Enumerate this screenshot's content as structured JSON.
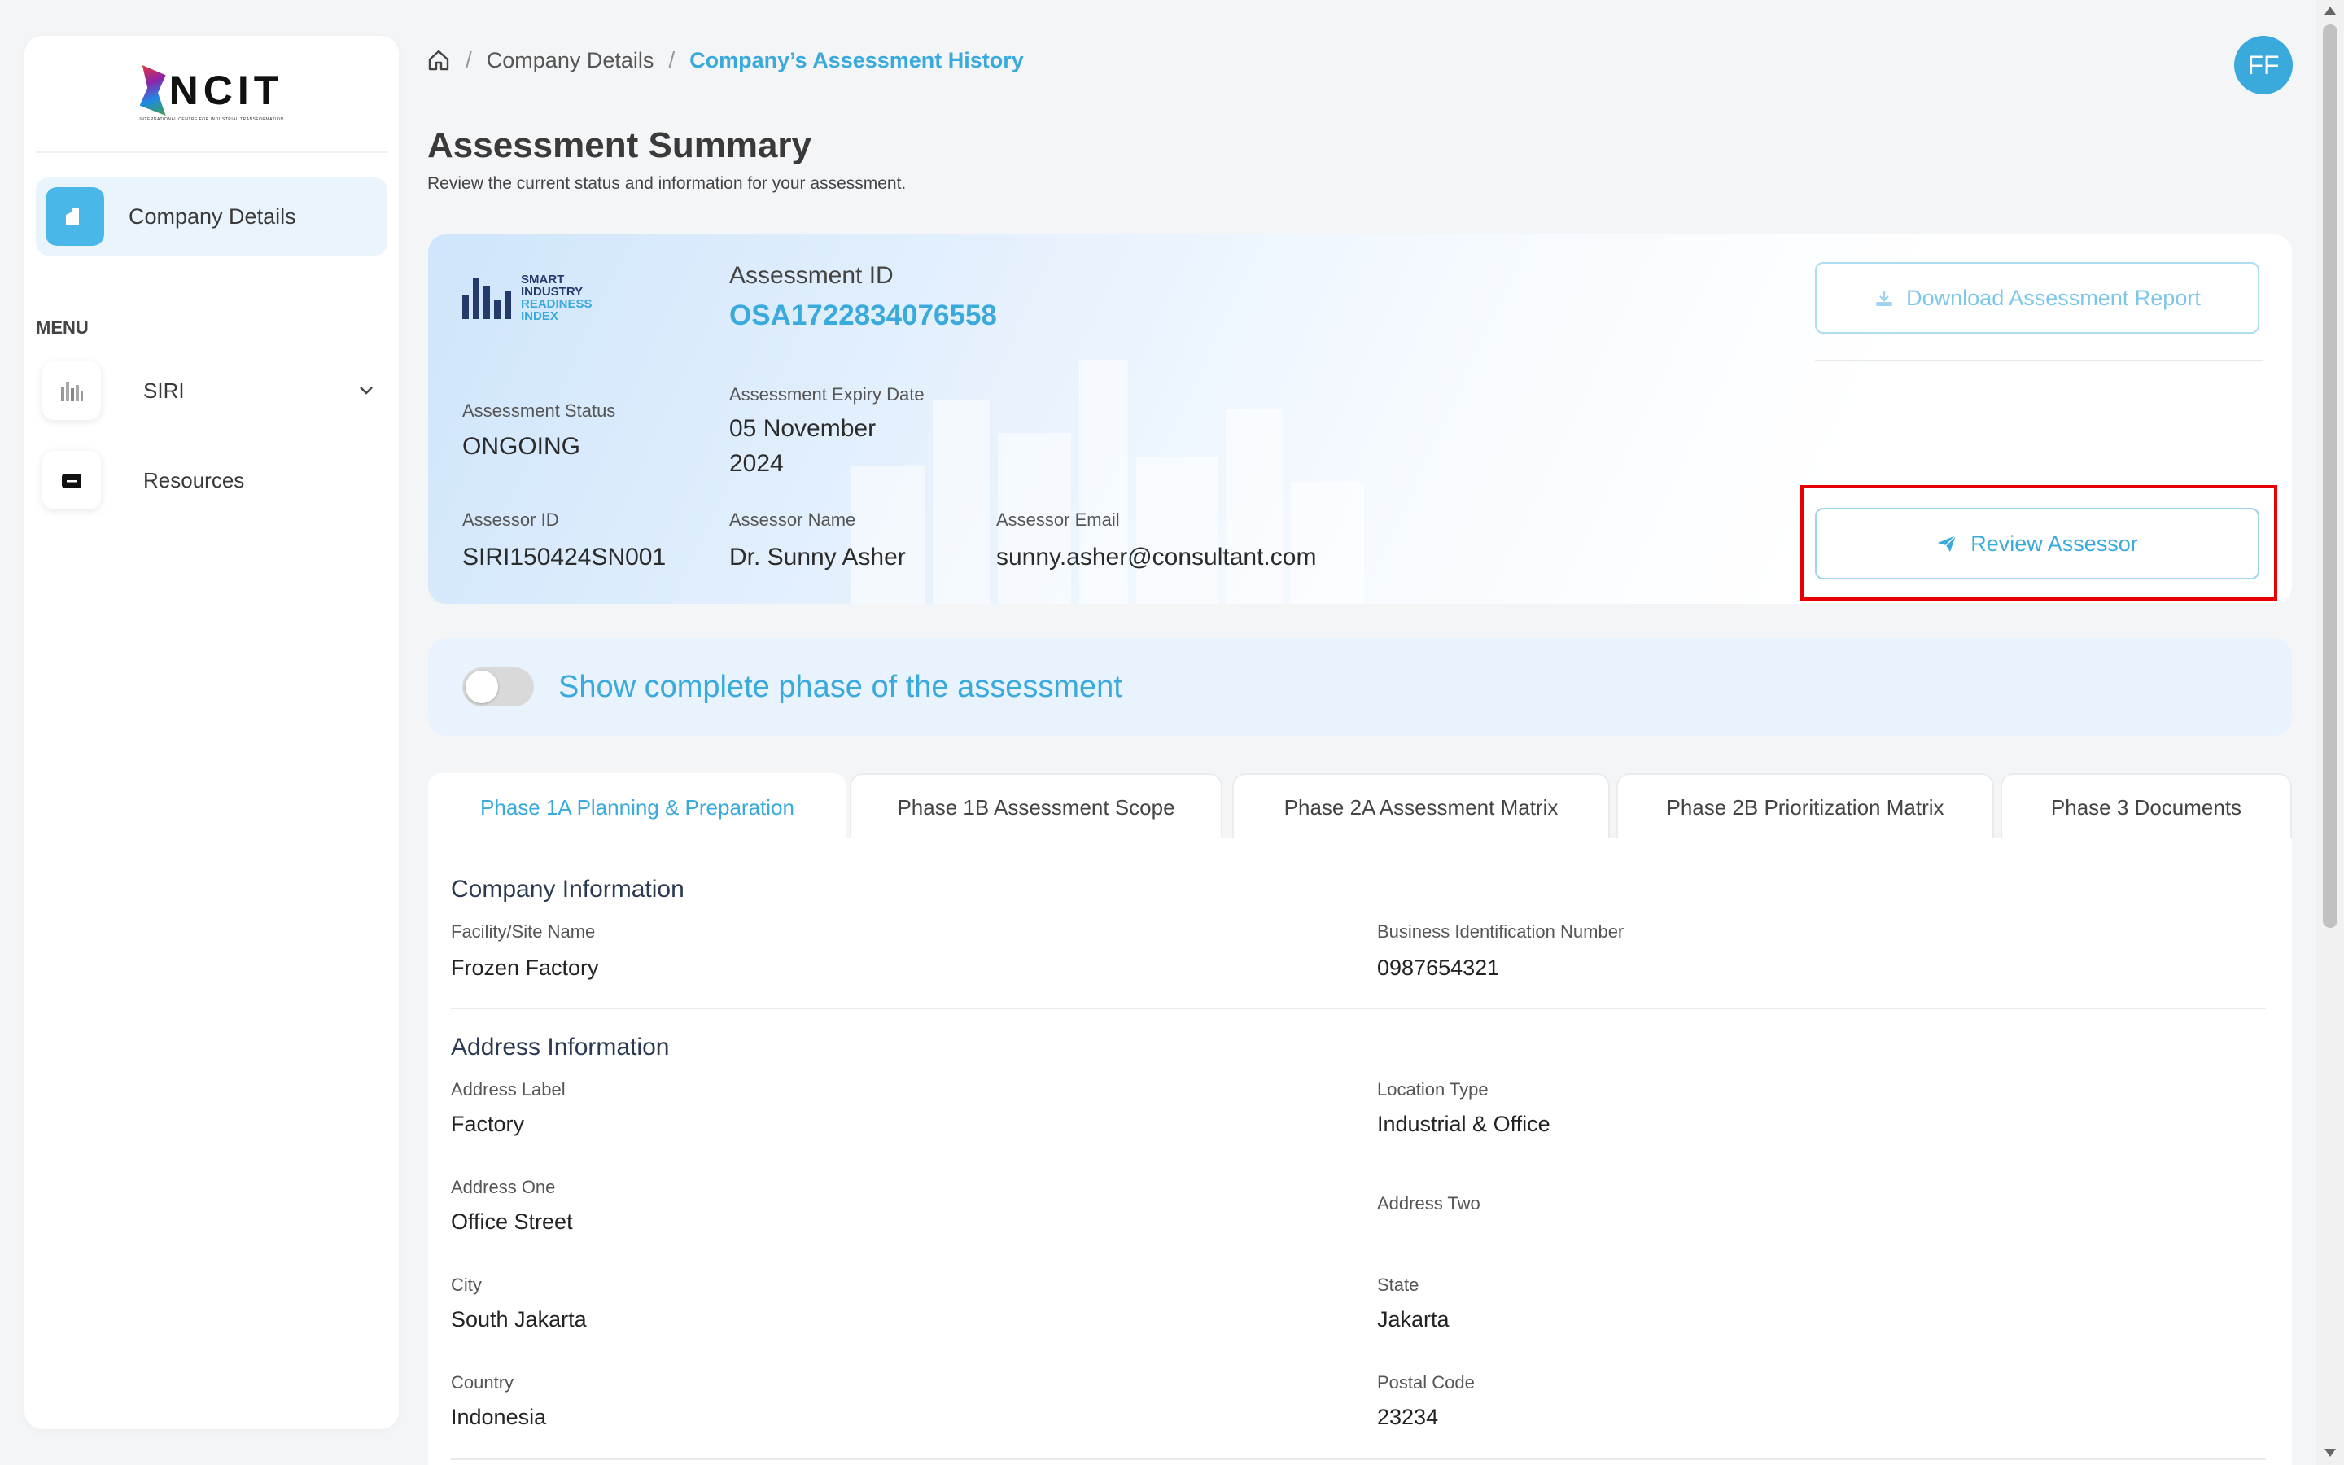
{
  "sidebar": {
    "logo_text": "NCIT",
    "logo_subtitle": "INTERNATIONAL CENTRE FOR INDUSTRIAL TRANSFORMATION",
    "company_details_label": "Company Details",
    "menu_title": "MENU",
    "items": [
      {
        "label": "SIRI",
        "icon": "bar-chart-icon"
      },
      {
        "label": "Resources",
        "icon": "folder-icon"
      }
    ]
  },
  "breadcrumb": {
    "items": [
      "Company Details",
      "Company’s Assessment History"
    ]
  },
  "avatar": {
    "initials": "FF"
  },
  "header": {
    "title": "Assessment Summary",
    "subtitle": "Review the current status and information for your assessment."
  },
  "summary": {
    "siri_logo": [
      "SMART",
      "INDUSTRY",
      "READINESS",
      "INDEX"
    ],
    "assessment_id_label": "Assessment ID",
    "assessment_id": "OSA1722834076558",
    "download_label": "Download Assessment Report",
    "status_label": "Assessment Status",
    "status": "ONGOING",
    "expiry_label": "Assessment Expiry Date",
    "expiry_line1": "05 November",
    "expiry_line2": "2024",
    "assessor_id_label": "Assessor ID",
    "assessor_id": "SIRI150424SN001",
    "assessor_name_label": "Assessor Name",
    "assessor_name": "Dr. Sunny Asher",
    "assessor_email_label": "Assessor Email",
    "assessor_email": "sunny.asher@consultant.com",
    "review_label": "Review Assessor"
  },
  "toggle": {
    "label": "Show complete phase of the assessment",
    "on": false
  },
  "tabs": [
    {
      "label": "Phase 1A Planning & Preparation",
      "active": true
    },
    {
      "label": "Phase 1B Assessment Scope",
      "active": false
    },
    {
      "label": "Phase 2A Assessment Matrix",
      "active": false
    },
    {
      "label": "Phase 2B Prioritization Matrix",
      "active": false
    },
    {
      "label": "Phase 3 Documents",
      "active": false
    }
  ],
  "company_info": {
    "title": "Company Information",
    "facility_label": "Facility/Site Name",
    "facility": "Frozen Factory",
    "bin_label": "Business Identification Number",
    "bin": "0987654321"
  },
  "address_info": {
    "title": "Address Information",
    "label_label": "Address Label",
    "label": "Factory",
    "location_type_label": "Location Type",
    "location_type": "Industrial & Office",
    "address_one_label": "Address One",
    "address_one": "Office Street",
    "address_two_label": "Address Two",
    "city_label": "City",
    "city": "South Jakarta",
    "state_label": "State",
    "state": "Jakarta",
    "country_label": "Country",
    "country": "Indonesia",
    "postal_label": "Postal Code",
    "postal": "23234"
  },
  "colors": {
    "accent": "#3aa9dc",
    "highlight": "#e60000"
  }
}
